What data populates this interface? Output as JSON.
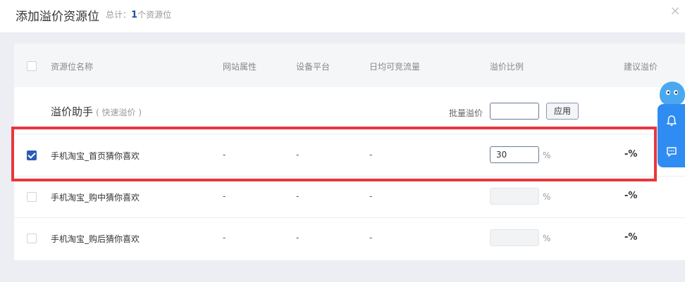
{
  "header": {
    "title": "添加溢价资源位",
    "total_label": "总计：",
    "total_count": "1",
    "total_suffix": "个资源位",
    "close_glyph": "×"
  },
  "table": {
    "columns": {
      "name": "资源位名称",
      "site": "网站属性",
      "device": "设备平台",
      "traffic": "日均可竞流量",
      "ratio": "溢价比例",
      "suggest": "建议溢价"
    },
    "helper": {
      "title": "溢价助手",
      "subtitle": "( 快速溢价 )",
      "batch_label": "批量溢价",
      "batch_value": "",
      "apply_label": "应用"
    },
    "rows": [
      {
        "name": "手机淘宝_首页猜你喜欢",
        "site": "-",
        "device": "-",
        "traffic": "-",
        "ratio": "30",
        "pct": "%",
        "suggest": "-%",
        "checked": true
      },
      {
        "name": "手机淘宝_购中猜你喜欢",
        "site": "-",
        "device": "-",
        "traffic": "-",
        "ratio": "",
        "pct": "%",
        "suggest": "-%",
        "checked": false
      },
      {
        "name": "手机淘宝_购后猜你喜欢",
        "site": "-",
        "device": "-",
        "traffic": "-",
        "ratio": "",
        "pct": "%",
        "suggest": "-%",
        "checked": false
      }
    ]
  },
  "colors": {
    "accent": "#2c5bb8",
    "highlight": "#e8373b",
    "widget": "#2f8cf2"
  },
  "icons": [
    "close-icon",
    "bell-icon",
    "chat-icon",
    "mascot-icon"
  ]
}
